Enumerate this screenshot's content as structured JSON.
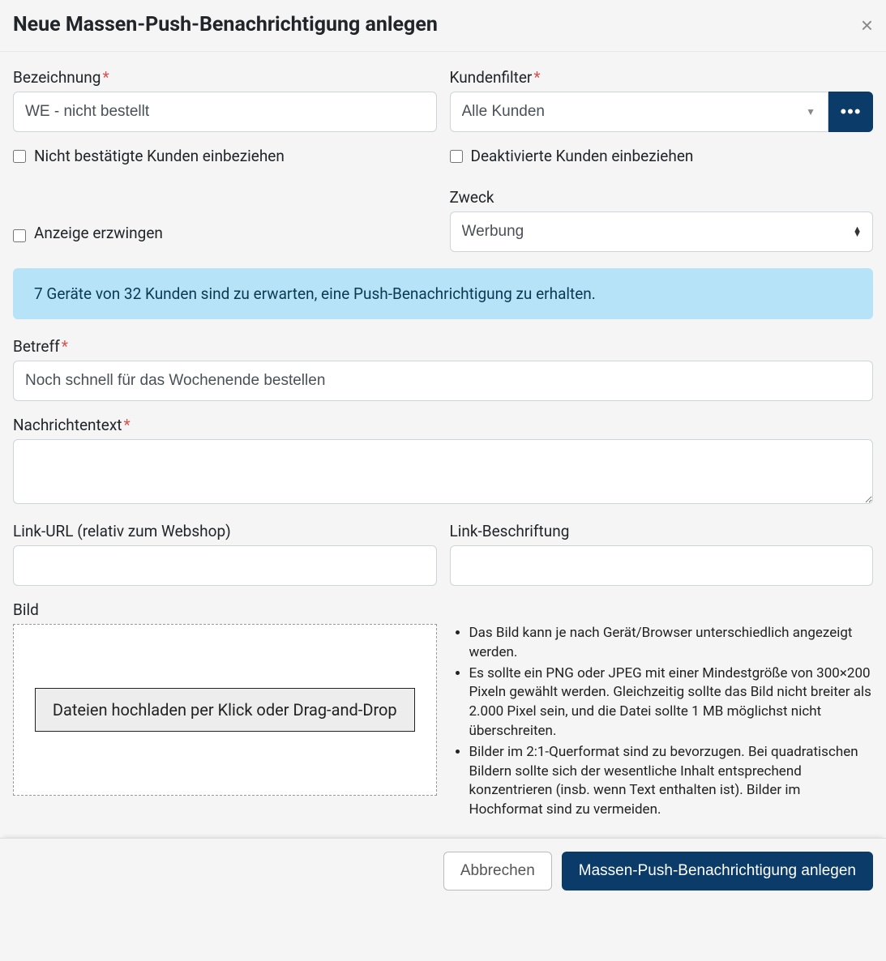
{
  "header": {
    "title": "Neue Massen-Push-Benachrichtigung anlegen"
  },
  "fields": {
    "bezeichnung": {
      "label": "Bezeichnung",
      "value": "WE - nicht bestellt"
    },
    "kundenfilter": {
      "label": "Kundenfilter",
      "value": "Alle Kunden"
    },
    "nicht_bestaetigt": {
      "label": "Nicht bestätigte Kunden einbeziehen",
      "checked": false
    },
    "deaktivierte": {
      "label": "Deaktivierte Kunden einbeziehen",
      "checked": false
    },
    "anzeige_erzwingen": {
      "label": "Anzeige erzwingen",
      "checked": false
    },
    "zweck": {
      "label": "Zweck",
      "value": "Werbung"
    },
    "betreff": {
      "label": "Betreff",
      "value": "Noch schnell für das Wochenende bestellen"
    },
    "nachrichtentext": {
      "label": "Nachrichtentext",
      "value": ""
    },
    "link_url": {
      "label": "Link-URL (relativ zum Webshop)",
      "value": ""
    },
    "link_beschriftung": {
      "label": "Link-Beschriftung",
      "value": ""
    },
    "bild": {
      "label": "Bild",
      "dropzone": "Dateien hochladen per Klick oder Drag-and-Drop",
      "hints": [
        "Das Bild kann je nach Gerät/Browser unterschiedlich angezeigt werden.",
        "Es sollte ein PNG oder JPEG mit einer Mindestgröße von 300×200 Pixeln gewählt werden. Gleichzeitig sollte das Bild nicht breiter als 2.000 Pixel sein, und die Datei sollte 1 MB möglichst nicht überschreiten.",
        "Bilder im 2:1-Querformat sind zu bevorzugen. Bei quadratischen Bildern sollte sich der wesentliche Inhalt entsprechend konzentrieren (insb. wenn Text enthalten ist). Bilder im Hochformat sind zu vermeiden."
      ]
    }
  },
  "info_banner": "7 Geräte von 32 Kunden sind zu erwarten, eine Push-Benachrichtigung zu erhalten.",
  "footer": {
    "cancel": "Abbrechen",
    "submit": "Massen-Push-Benachrichtigung anlegen"
  }
}
